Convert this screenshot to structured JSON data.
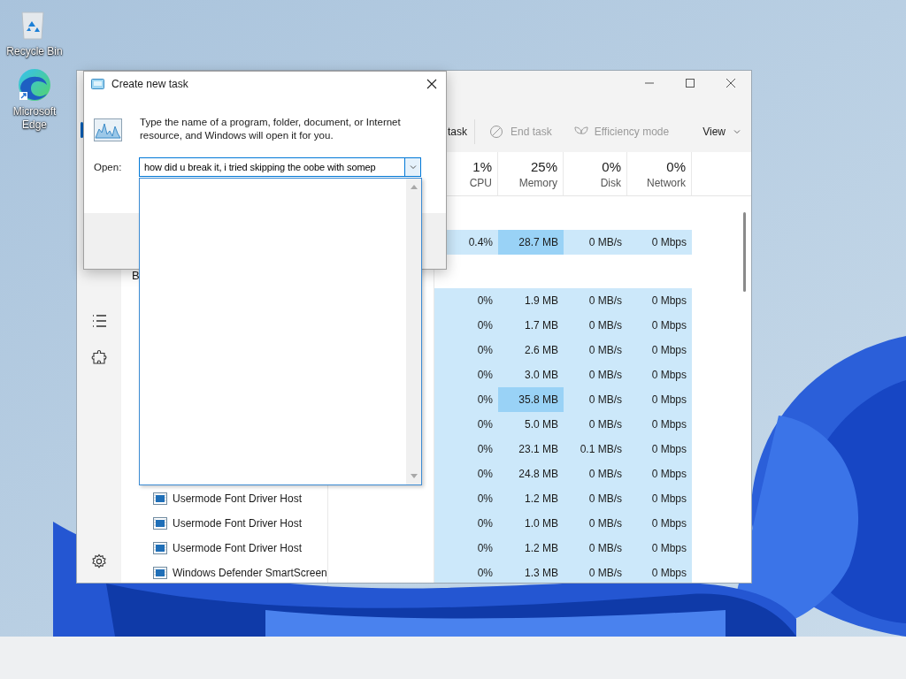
{
  "desktop": {
    "icons": [
      {
        "kind": "recycle_bin",
        "label": "Recycle Bin"
      },
      {
        "kind": "browser",
        "label": "Microsoft Edge"
      }
    ]
  },
  "task_manager": {
    "nav": [
      {
        "kind": "processes",
        "selected": true
      },
      {
        "kind": "details",
        "selected": false
      },
      {
        "kind": "services",
        "selected": false
      },
      {
        "kind": "settings",
        "selected": false
      }
    ],
    "toolbar": [
      {
        "kind": "run",
        "label": "task",
        "disabled": false
      },
      {
        "kind": "end",
        "label": "End task",
        "disabled": true
      },
      {
        "kind": "efficiency",
        "label": "Efficiency mode",
        "disabled": true
      },
      {
        "kind": "view",
        "label": "View",
        "disabled": false
      }
    ],
    "columns": [
      {
        "percent": "1%",
        "name": "CPU"
      },
      {
        "percent": "25%",
        "name": "Memory"
      },
      {
        "percent": "0%",
        "name": "Disk"
      },
      {
        "percent": "0%",
        "name": "Network"
      }
    ],
    "rows": [
      {
        "kind": "process",
        "cpu": "0.4%",
        "memory": "28.7 MB",
        "memory_highlight": true,
        "disk": "0 MB/s",
        "network": "0 Mbps"
      },
      {
        "kind": "group",
        "name": "B"
      },
      {
        "kind": "process",
        "cpu": "0%",
        "memory": "1.9 MB",
        "memory_highlight": false,
        "disk": "0 MB/s",
        "network": "0 Mbps"
      },
      {
        "kind": "process",
        "cpu": "0%",
        "memory": "1.7 MB",
        "memory_highlight": false,
        "disk": "0 MB/s",
        "network": "0 Mbps"
      },
      {
        "kind": "process",
        "cpu": "0%",
        "memory": "2.6 MB",
        "memory_highlight": false,
        "disk": "0 MB/s",
        "network": "0 Mbps"
      },
      {
        "kind": "process",
        "cpu": "0%",
        "memory": "3.0 MB",
        "memory_highlight": false,
        "disk": "0 MB/s",
        "network": "0 Mbps"
      },
      {
        "kind": "process",
        "cpu": "0%",
        "memory": "35.8 MB",
        "memory_highlight": true,
        "disk": "0 MB/s",
        "network": "0 Mbps"
      },
      {
        "kind": "process",
        "cpu": "0%",
        "memory": "5.0 MB",
        "memory_highlight": false,
        "disk": "0 MB/s",
        "network": "0 Mbps"
      },
      {
        "kind": "process",
        "cpu": "0%",
        "memory": "23.1 MB",
        "memory_highlight": false,
        "disk": "0.1 MB/s",
        "network": "0 Mbps"
      },
      {
        "kind": "process",
        "cpu": "0%",
        "memory": "24.8 MB",
        "memory_highlight": false,
        "disk": "0 MB/s",
        "network": "0 Mbps"
      },
      {
        "kind": "process",
        "name": "Usermode Font Driver Host",
        "cpu": "0%",
        "memory": "1.2 MB",
        "memory_highlight": false,
        "disk": "0 MB/s",
        "network": "0 Mbps"
      },
      {
        "kind": "process",
        "name": "Usermode Font Driver Host",
        "cpu": "0%",
        "memory": "1.0 MB",
        "memory_highlight": false,
        "disk": "0 MB/s",
        "network": "0 Mbps"
      },
      {
        "kind": "process",
        "name": "Usermode Font Driver Host",
        "cpu": "0%",
        "memory": "1.2 MB",
        "memory_highlight": false,
        "disk": "0 MB/s",
        "network": "0 Mbps"
      },
      {
        "kind": "process",
        "name": "Windows Defender SmartScreen",
        "cpu": "0%",
        "memory": "1.3 MB",
        "memory_highlight": false,
        "disk": "0 MB/s",
        "network": "0 Mbps"
      }
    ]
  },
  "dialog": {
    "title": "Create new task",
    "message": "Type the name of a program, folder, document, or Internet resource, and Windows will open it for you.",
    "open_label": "Open:",
    "open_value": "how did u break it, i tried skipping the oobe with somep"
  }
}
